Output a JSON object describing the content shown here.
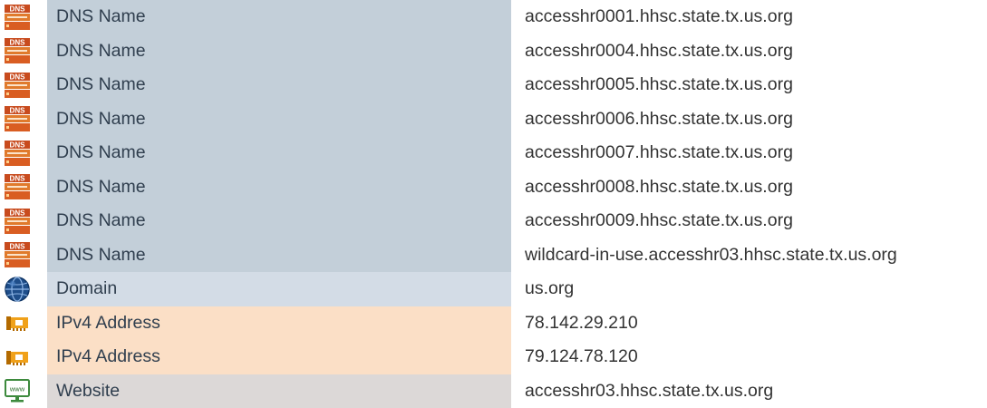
{
  "rows": [
    {
      "type": "DNS Name",
      "value": "accesshr0001.hhsc.state.tx.us.org",
      "icon": "dns-icon",
      "kind": "dns"
    },
    {
      "type": "DNS Name",
      "value": "accesshr0004.hhsc.state.tx.us.org",
      "icon": "dns-icon",
      "kind": "dns"
    },
    {
      "type": "DNS Name",
      "value": "accesshr0005.hhsc.state.tx.us.org",
      "icon": "dns-icon",
      "kind": "dns"
    },
    {
      "type": "DNS Name",
      "value": "accesshr0006.hhsc.state.tx.us.org",
      "icon": "dns-icon",
      "kind": "dns"
    },
    {
      "type": "DNS Name",
      "value": "accesshr0007.hhsc.state.tx.us.org",
      "icon": "dns-icon",
      "kind": "dns"
    },
    {
      "type": "DNS Name",
      "value": "accesshr0008.hhsc.state.tx.us.org",
      "icon": "dns-icon",
      "kind": "dns"
    },
    {
      "type": "DNS Name",
      "value": "accesshr0009.hhsc.state.tx.us.org",
      "icon": "dns-icon",
      "kind": "dns"
    },
    {
      "type": "DNS Name",
      "value": "wildcard-in-use.accesshr03.hhsc.state.tx.us.org",
      "icon": "dns-icon",
      "kind": "dns"
    },
    {
      "type": "Domain",
      "value": "us.org",
      "icon": "globe-icon",
      "kind": "domain"
    },
    {
      "type": "IPv4 Address",
      "value": "78.142.29.210",
      "icon": "network-card-icon",
      "kind": "ipv4"
    },
    {
      "type": "IPv4 Address",
      "value": "79.124.78.120",
      "icon": "network-card-icon",
      "kind": "ipv4"
    },
    {
      "type": "Website",
      "value": "accesshr03.hhsc.state.tx.us.org",
      "icon": "www-icon",
      "kind": "website"
    }
  ],
  "icon_labels": {
    "dns": "DNS",
    "www": "www"
  },
  "colors": {
    "dns_row": "#c3cfd9",
    "domain_row": "#d3dce6",
    "ipv4_row": "#fbdfc6",
    "website_row": "#dcd8d7"
  }
}
